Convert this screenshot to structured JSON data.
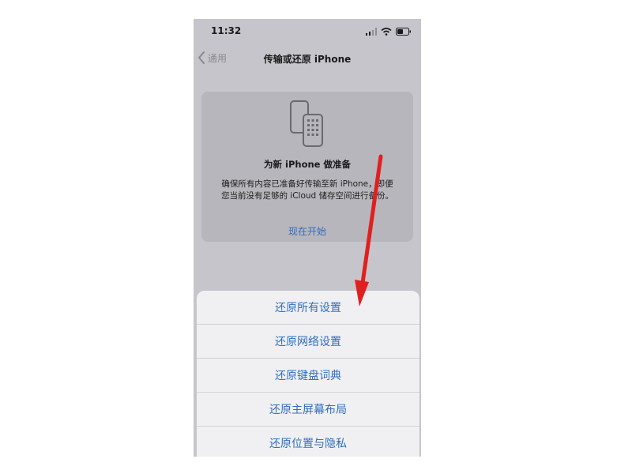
{
  "status_bar": {
    "time": "11:32"
  },
  "nav": {
    "back_label": "通用",
    "title": "传输或还原 iPhone"
  },
  "card": {
    "title": "为新 iPhone 做准备",
    "description_lines": [
      "确保所有内容已准备好传输至新 iPhone，即便",
      "您当前没有足够的 iCloud 储存空间进行备份。"
    ],
    "action_label": "现在开始"
  },
  "reset_sheet": {
    "items": [
      "还原所有设置",
      "还原网络设置",
      "还原键盘词典",
      "还原主屏幕布局",
      "还原位置与隐私"
    ]
  },
  "colors": {
    "accent": "#2f6fc0",
    "annotation_arrow": "#e02020",
    "dim_background": "#c6c5cb"
  },
  "icons": [
    "signal-icon",
    "wifi-icon",
    "battery-icon",
    "chevron-left-icon",
    "phone-transfer-icon"
  ]
}
